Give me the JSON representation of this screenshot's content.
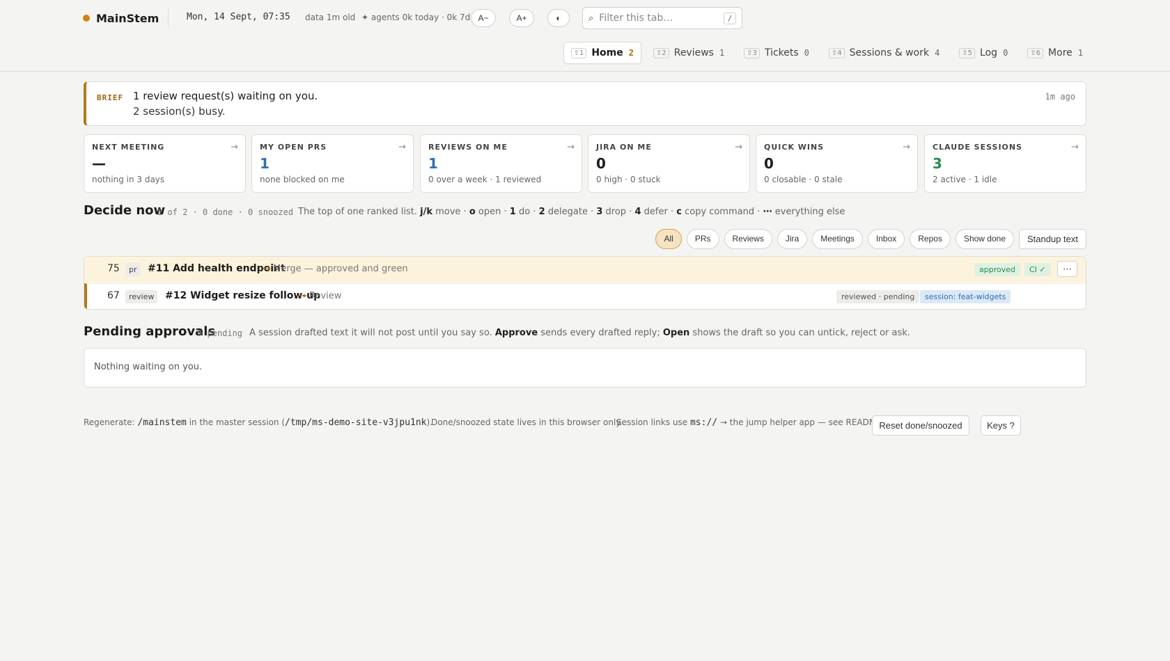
{
  "header": {
    "brand": "MainStem",
    "clock": "Mon, 14 Sept, 07:35",
    "data_age": "data 1m old",
    "agents": "✦ agents 0k today · 0k 7d",
    "font_smaller": "A−",
    "font_larger": "A+",
    "theme_icon": "◐",
    "search_placeholder": "Filter this tab…",
    "search_key": "/"
  },
  "tabs": [
    {
      "key": "⇧1",
      "label": "Home",
      "count": "2"
    },
    {
      "key": "⇧2",
      "label": "Reviews",
      "count": "1"
    },
    {
      "key": "⇧3",
      "label": "Tickets",
      "count": "0"
    },
    {
      "key": "⇧4",
      "label": "Sessions & work",
      "count": "4"
    },
    {
      "key": "⇧5",
      "label": "Log",
      "count": "0"
    },
    {
      "key": "⇧6",
      "label": "More",
      "count": "1"
    }
  ],
  "brief": {
    "tag": "BRIEF",
    "line1": "1 review request(s) waiting on you.",
    "line2": "2 session(s) busy.",
    "time": "1m ago"
  },
  "cards": [
    {
      "title": "NEXT MEETING",
      "value": "—",
      "sub": "nothing in 3 days"
    },
    {
      "title": "MY OPEN PRS",
      "value": "1",
      "sub": "none blocked on me"
    },
    {
      "title": "REVIEWS ON ME",
      "value": "1",
      "sub": "0 over a week · 1 reviewed"
    },
    {
      "title": "JIRA ON ME",
      "value": "0",
      "sub": "0 high · 0 stuck"
    },
    {
      "title": "QUICK WINS",
      "value": "0",
      "sub": "0 closable · 0 stale"
    },
    {
      "title": "CLAUDE SESSIONS",
      "value": "3",
      "sub": "2 active · 1 idle"
    }
  ],
  "card_arrow": "→",
  "decide": {
    "title": "Decide now",
    "meta": "2 of 2 · 0 done · 0 snoozed",
    "desc_prefix": "The top of one ranked list.",
    "hints": [
      {
        "k": "j/k",
        "t": "move ·"
      },
      {
        "k": "o",
        "t": "open ·"
      },
      {
        "k": "1",
        "t": "do ·"
      },
      {
        "k": "2",
        "t": "delegate ·"
      },
      {
        "k": "3",
        "t": "drop ·"
      },
      {
        "k": "4",
        "t": "defer ·"
      },
      {
        "k": "c",
        "t": "copy command ·"
      },
      {
        "k": "⋯",
        "t": "everything else"
      }
    ]
  },
  "filters": [
    "All",
    "PRs",
    "Reviews",
    "Jira",
    "Meetings",
    "Inbox",
    "Repos",
    "Show done"
  ],
  "standup_label": "Standup text",
  "rows": [
    {
      "score": "75",
      "kind": "pr",
      "title": "#11 Add health endpoint",
      "arrow": "→",
      "action": "Merge — approved and green",
      "pill1": "approved",
      "pill2": "CI ✓",
      "more": "⋯"
    },
    {
      "score": "67",
      "kind": "review",
      "title": "#12 Widget resize follow-up",
      "arrow": "→",
      "action": "Review",
      "pill1": "reviewed · pending",
      "pill2": "session: feat-widgets"
    }
  ],
  "pending": {
    "title": "Pending approvals",
    "meta": "0 pending",
    "desc1": "A session drafted text it will not post until you say so.",
    "approve": "Approve",
    "desc2": "sends every drafted reply;",
    "open": "Open",
    "desc3": "shows the draft so you can untick, reject or ask.",
    "empty": "Nothing waiting on you."
  },
  "footer": {
    "regen_prefix": "Regenerate:",
    "regen_cmd": "/mainstem",
    "regen_mid": "in the master session (",
    "regen_path": "/tmp/ms-demo-site-v3jpu1nk",
    "regen_end": ").",
    "state_note": "Done/snoozed state lives in this browser only.",
    "links_prefix": "Session links use",
    "links_scheme": "ms://",
    "links_suffix": "→ the jump helper app — see README.",
    "reset_label": "Reset done/snoozed",
    "keys_label": "Keys ?"
  },
  "colors": {
    "accent": "#b07a1a",
    "brand_dot": "#d4820e",
    "blue": "#2f6fb5",
    "green": "#2b8a4e"
  }
}
